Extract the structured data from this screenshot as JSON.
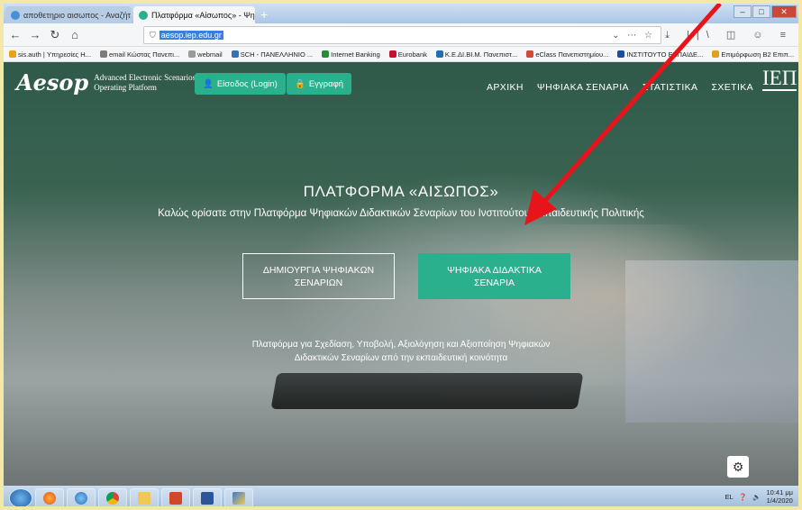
{
  "browser": {
    "tabs": [
      {
        "label": "αποθετηριο αισωπος - Αναζήτ",
        "active": false
      },
      {
        "label": "Πλατφόρμα «Αίσωπος» - Ψηφι",
        "active": true
      }
    ],
    "url": "aesop.iep.edu.gr",
    "bookmarks": [
      "sis.auth | Υπηρεσίες Η...",
      "email Κώστας Πανεπι...",
      "webmail",
      "SCH - ΠΑΝΕΛΛΗΝΙΟ ...",
      "Internet Banking",
      "Eurobank",
      "Κ.Ε.ΔΙ.ΒΙ.Μ. Πανεπιστ...",
      "eClass Πανεπιστημίου...",
      "ΙΝΣΤΙΤΟΥΤΟ ΕΚΠΑΙΔΕ...",
      "Επιμόρφωση Β2 Επιπ..."
    ]
  },
  "site": {
    "logo_mark": "Aesop",
    "logo_line1": "Advanced Electronic Scenarios",
    "logo_line2": "Operating Platform",
    "login_label": "Είσοδος (Login)",
    "register_label": "Εγγραφή",
    "nav": [
      "ΑΡΧΙΚΗ",
      "ΨΗΦΙΑΚΑ ΣΕΝΑΡΙΑ",
      "ΣΤΑΤΙΣΤΙΚΑ",
      "ΣΧΕΤΙΚΑ"
    ],
    "partner_logo": "ΙΕΠ",
    "hero_title": "ΠΛΑΤΦΟΡΜΑ «ΑΙΣΩΠΟΣ»",
    "hero_subtitle": "Καλώς ορίσατε στην Πλατφόρμα Ψηφιακών Διδακτικών Σεναρίων του Ινστιτούτου Εκπαιδευτικής Πολιτικής",
    "cta_create": "ΔΗΜΙΟΥΡΓΙΑ ΨΗΦΙΑΚΩΝ ΣΕΝΑΡΙΩΝ",
    "cta_browse": "ΨΗΦΙΑΚΑ ΔΙΔΑΚΤΙΚΑ ΣΕΝΑΡΙΑ",
    "tagline_line1": "Πλατφόρμα για Σχεδίαση, Υποβολή, Αξιολόγηση και Αξιοποίηση Ψηφιακών",
    "tagline_line2": "Διδακτικών Σεναρίων από την εκπαιδευτική κοινότητα"
  },
  "taskbar": {
    "lang": "EL",
    "time": "10:41 μμ",
    "date": "1/4/2020"
  },
  "colors": {
    "accent": "#2bb08d",
    "annotation_arrow": "#e8141b"
  }
}
